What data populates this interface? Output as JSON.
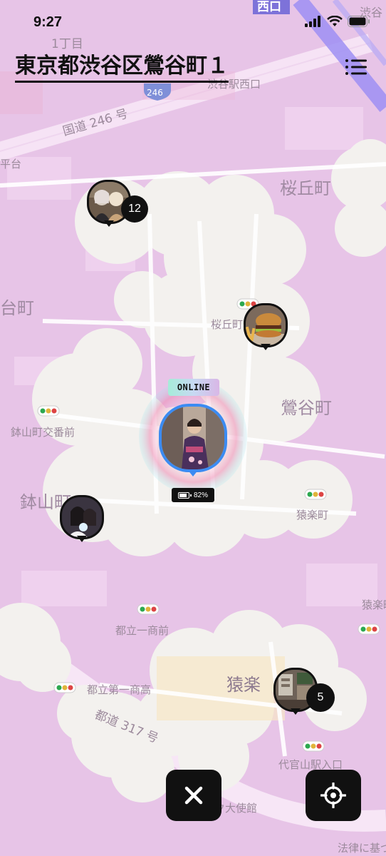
{
  "status_bar": {
    "time": "9:27"
  },
  "header": {
    "title": "東京都渋谷区鶯谷町１"
  },
  "map": {
    "labels": [
      {
        "text": "西口"
      },
      {
        "text": "渋谷"
      },
      {
        "text": "1丁目"
      },
      {
        "text": "渋谷駅西口"
      },
      {
        "text": "246"
      },
      {
        "text": "国道 246 号"
      },
      {
        "text": "平台"
      },
      {
        "text": "桜丘町"
      },
      {
        "text": "台町"
      },
      {
        "text": "桜丘町"
      },
      {
        "text": "鶯谷町"
      },
      {
        "text": "鉢山町交番前"
      },
      {
        "text": "鉢山町"
      },
      {
        "text": "猿楽町"
      },
      {
        "text": "猿楽"
      },
      {
        "text": "都立一商前"
      },
      {
        "text": "都立第一商高"
      },
      {
        "text": "猿楽町"
      },
      {
        "text": "都道 317 号"
      },
      {
        "text": "代官山駅入口"
      },
      {
        "text": "ク大使館"
      },
      {
        "text": "法律に基づ"
      }
    ]
  },
  "markers": [
    {
      "name": "friends-group",
      "count": "12"
    },
    {
      "name": "burger"
    },
    {
      "name": "girls-selfie"
    },
    {
      "name": "shop-interior",
      "count": "5"
    }
  ],
  "me": {
    "status": "ONLINE",
    "battery_text": "82%",
    "battery_level": 0.82
  },
  "colors": {
    "accent_blue": "#3b8bf2",
    "ink": "#111111",
    "map_tint": "#e9c6e8"
  }
}
